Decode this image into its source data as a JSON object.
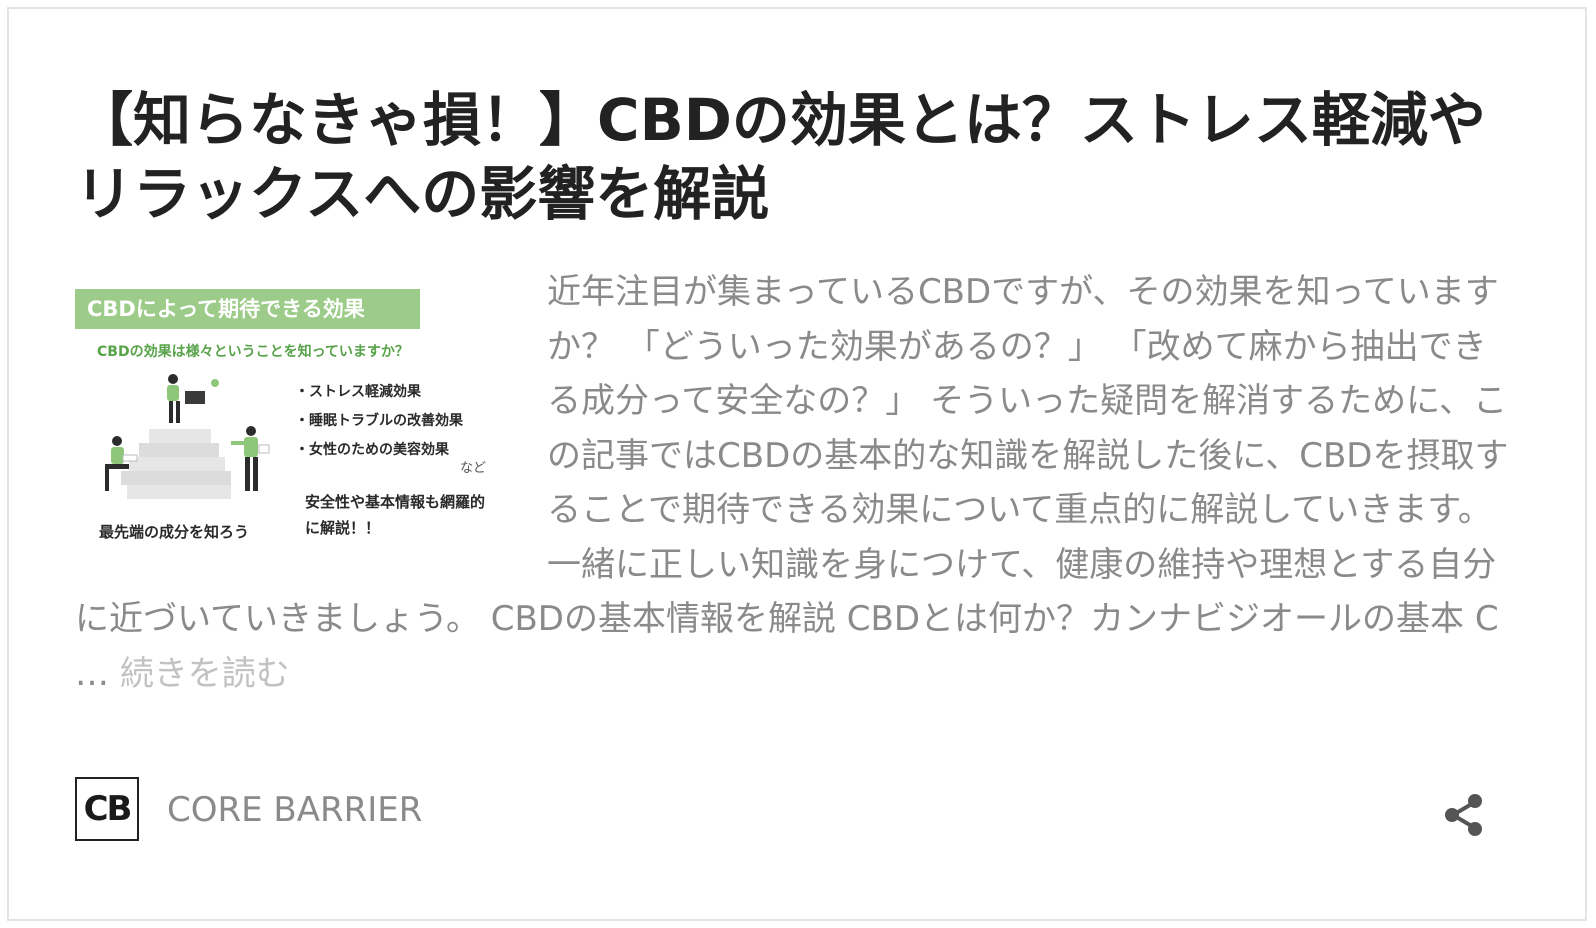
{
  "article": {
    "title": "【知らなきゃ損！】CBDの効果とは？ストレス軽減やリラックスへの影響を解説",
    "excerpt": "近年注目が集まっているCBDですが、その効果を知っていますか？ 「どういった効果があるの？」 「改めて麻から抽出できる成分って安全なの？」 そういった疑問を解消するために、この記事ではCBDの基本的な知識を解説した後に、CBDを摂取することで期待できる効果について重点的に解説していきます。 一緒に正しい知識を身につけて、健康の維持や理想とする自分に近づいていきましょう。 CBDの基本情報を解説 CBDとは何か？カンナビジオールの基本 C … ",
    "read_more": "続きを読む"
  },
  "thumbnail": {
    "header": "CBDによって期待できる効果",
    "subheading": "CBDの効果は様々ということを知っていますか？",
    "bullets": [
      "・ストレス軽減効果",
      "・睡眠トラブルの改善効果",
      "・女性のための美容効果"
    ],
    "etc": "など",
    "safety": "安全性や基本情報も網羅的に解説！！",
    "tagline": "最先端の成分を知ろう",
    "accent_color": "#9ccb8a"
  },
  "footer": {
    "logo_text": "CB",
    "brand": "CORE BARRIER",
    "share_icon": "share-icon"
  }
}
